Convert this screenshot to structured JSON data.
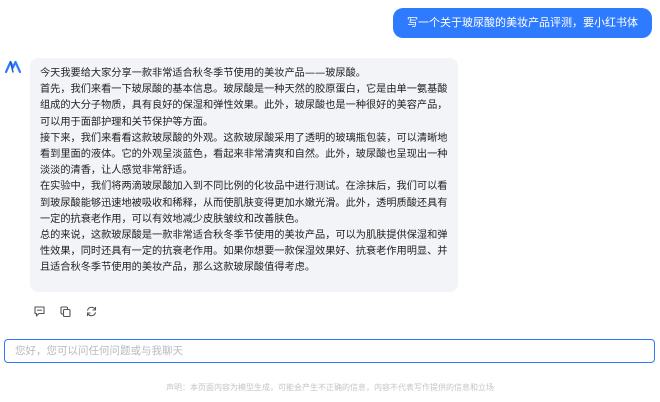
{
  "user_message": "写一个关于玻尿酸的美妆产品评测，要小红书体",
  "assistant": {
    "avatar_icon": "m-logo-icon",
    "paragraphs": [
      "今天我要给大家分享一款非常适合秋冬季节使用的美妆产品——玻尿酸。",
      "首先，我们来看一下玻尿酸的基本信息。玻尿酸是一种天然的胶原蛋白，它是由单一氨基酸组成的大分子物质，具有良好的保湿和弹性效果。此外，玻尿酸也是一种很好的美容产品，可以用于面部护理和关节保护等方面。",
      "接下来，我们来看看这款玻尿酸的外观。这款玻尿酸采用了透明的玻璃瓶包装，可以清晰地看到里面的液体。它的外观呈淡蓝色，看起来非常清爽和自然。此外，玻尿酸也呈现出一种淡淡的清香，让人感觉非常舒适。",
      "在实验中，我们将两滴玻尿酸加入到不同比例的化妆品中进行测试。在涂抹后，我们可以看到玻尿酸能够迅速地被吸收和稀释，从而使肌肤变得更加水嫩光滑。此外，透明质酸还具有一定的抗衰老作用，可以有效地减少皮肤皱纹和改善肤色。",
      "总的来说，这款玻尿酸是一款非常适合秋冬季节使用的美妆产品，可以为肌肤提供保湿和弹性效果，同时还具有一定的抗衰老作用。如果你想要一款保湿效果好、抗衰老作用明显、并且适合秋冬季节使用的美妆产品，那么这款玻尿酸值得考虑。"
    ]
  },
  "actions": [
    {
      "name": "comment-icon"
    },
    {
      "name": "copy-icon"
    },
    {
      "name": "refresh-icon"
    }
  ],
  "input": {
    "placeholder": "您好，您可以问任何问题或与我聊天",
    "value": ""
  },
  "disclaimer": "声明：本页面内容为模型生成，可能会产生不正确的信息，内容不代表写作提供的信息和立场",
  "colors": {
    "accent": "#2f7bff",
    "bubble_bg": "#f2f4f7"
  }
}
